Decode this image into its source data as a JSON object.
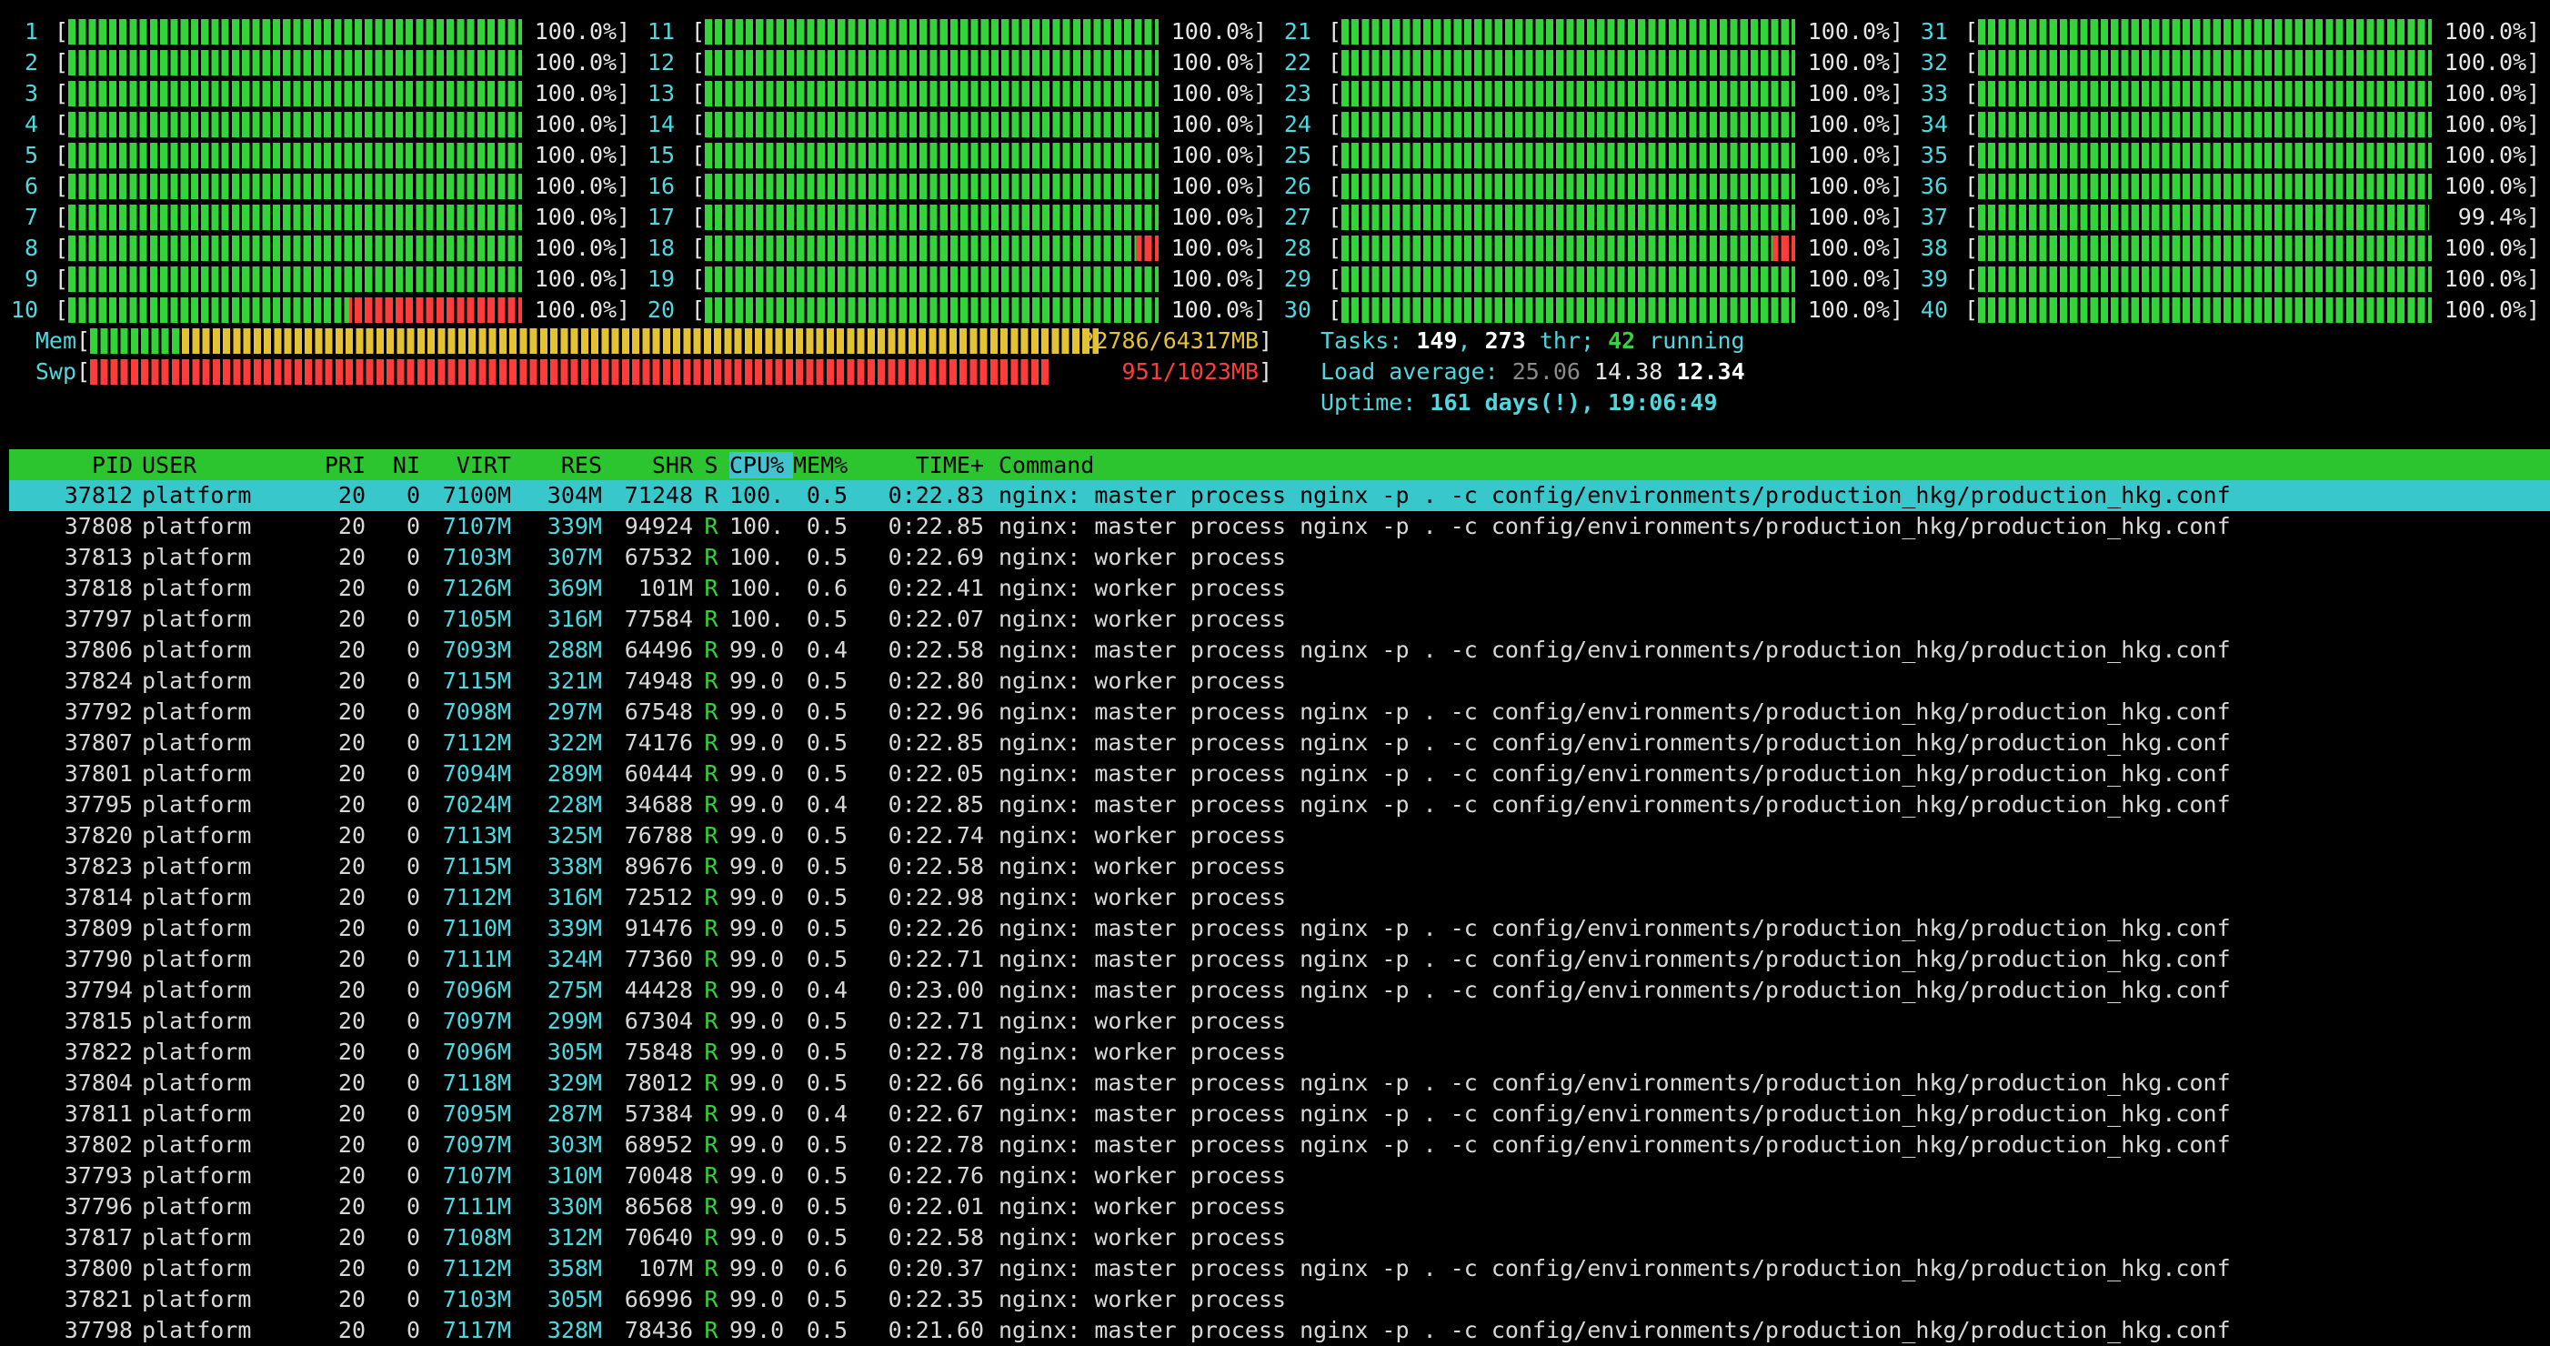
{
  "colors": {
    "green": "#33d43a",
    "red": "#ff3c3c",
    "cyan": "#4fd7df",
    "yellow": "#e3c234",
    "header_bg": "#2dc52f",
    "selected_bg": "#38c8cc"
  },
  "cpus": [
    {
      "n": "1",
      "pct": "100.0%",
      "usage": 1.0,
      "sys": 0
    },
    {
      "n": "2",
      "pct": "100.0%",
      "usage": 1.0,
      "sys": 0
    },
    {
      "n": "3",
      "pct": "100.0%",
      "usage": 1.0,
      "sys": 0
    },
    {
      "n": "4",
      "pct": "100.0%",
      "usage": 1.0,
      "sys": 0
    },
    {
      "n": "5",
      "pct": "100.0%",
      "usage": 1.0,
      "sys": 0
    },
    {
      "n": "6",
      "pct": "100.0%",
      "usage": 1.0,
      "sys": 0
    },
    {
      "n": "7",
      "pct": "100.0%",
      "usage": 1.0,
      "sys": 0
    },
    {
      "n": "8",
      "pct": "100.0%",
      "usage": 1.0,
      "sys": 0
    },
    {
      "n": "9",
      "pct": "100.0%",
      "usage": 1.0,
      "sys": 0
    },
    {
      "n": "10",
      "pct": "100.0%",
      "usage": 1.0,
      "sys": 0.38
    },
    {
      "n": "11",
      "pct": "100.0%",
      "usage": 1.0,
      "sys": 0
    },
    {
      "n": "12",
      "pct": "100.0%",
      "usage": 1.0,
      "sys": 0
    },
    {
      "n": "13",
      "pct": "100.0%",
      "usage": 1.0,
      "sys": 0
    },
    {
      "n": "14",
      "pct": "100.0%",
      "usage": 1.0,
      "sys": 0
    },
    {
      "n": "15",
      "pct": "100.0%",
      "usage": 1.0,
      "sys": 0
    },
    {
      "n": "16",
      "pct": "100.0%",
      "usage": 1.0,
      "sys": 0
    },
    {
      "n": "17",
      "pct": "100.0%",
      "usage": 1.0,
      "sys": 0
    },
    {
      "n": "18",
      "pct": "100.0%",
      "usage": 1.0,
      "sys": 0.05
    },
    {
      "n": "19",
      "pct": "100.0%",
      "usage": 1.0,
      "sys": 0
    },
    {
      "n": "20",
      "pct": "100.0%",
      "usage": 1.0,
      "sys": 0
    },
    {
      "n": "21",
      "pct": "100.0%",
      "usage": 1.0,
      "sys": 0
    },
    {
      "n": "22",
      "pct": "100.0%",
      "usage": 1.0,
      "sys": 0
    },
    {
      "n": "23",
      "pct": "100.0%",
      "usage": 1.0,
      "sys": 0
    },
    {
      "n": "24",
      "pct": "100.0%",
      "usage": 1.0,
      "sys": 0
    },
    {
      "n": "25",
      "pct": "100.0%",
      "usage": 1.0,
      "sys": 0
    },
    {
      "n": "26",
      "pct": "100.0%",
      "usage": 1.0,
      "sys": 0
    },
    {
      "n": "27",
      "pct": "100.0%",
      "usage": 1.0,
      "sys": 0
    },
    {
      "n": "28",
      "pct": "100.0%",
      "usage": 1.0,
      "sys": 0.05
    },
    {
      "n": "29",
      "pct": "100.0%",
      "usage": 1.0,
      "sys": 0
    },
    {
      "n": "30",
      "pct": "100.0%",
      "usage": 1.0,
      "sys": 0
    },
    {
      "n": "31",
      "pct": "100.0%",
      "usage": 1.0,
      "sys": 0
    },
    {
      "n": "32",
      "pct": "100.0%",
      "usage": 1.0,
      "sys": 0
    },
    {
      "n": "33",
      "pct": "100.0%",
      "usage": 1.0,
      "sys": 0
    },
    {
      "n": "34",
      "pct": "100.0%",
      "usage": 1.0,
      "sys": 0
    },
    {
      "n": "35",
      "pct": "100.0%",
      "usage": 1.0,
      "sys": 0
    },
    {
      "n": "36",
      "pct": "100.0%",
      "usage": 1.0,
      "sys": 0
    },
    {
      "n": "37",
      "pct": "99.4%",
      "usage": 0.994,
      "sys": 0
    },
    {
      "n": "38",
      "pct": "100.0%",
      "usage": 1.0,
      "sys": 0
    },
    {
      "n": "39",
      "pct": "100.0%",
      "usage": 1.0,
      "sys": 0
    },
    {
      "n": "40",
      "pct": "100.0%",
      "usage": 1.0,
      "sys": 0
    }
  ],
  "mem": {
    "label": "Mem",
    "value": "22786/64317MB",
    "used": 0.354
  },
  "swp": {
    "label": "Swp",
    "value": "951/1023MB",
    "used": 0.93
  },
  "tasks": {
    "label": "Tasks: ",
    "count": "149",
    "sep": ", ",
    "threads": "273",
    "thr_label": " thr; ",
    "running": "42",
    "running_label": " running"
  },
  "load": {
    "label": "Load average: ",
    "l1": "25.06",
    "l5": "14.38",
    "l15": "12.34"
  },
  "uptime": {
    "label": "Uptime: ",
    "value": "161 days(!), 19:06:49"
  },
  "header": {
    "pid": "PID",
    "user": "USER",
    "pri": "PRI",
    "ni": "NI",
    "virt": "VIRT",
    "res": "RES",
    "shr": "SHR",
    "s": "S",
    "cpu": "CPU%",
    "mem": "MEM%",
    "time": "TIME+",
    "command": "Command"
  },
  "processes": [
    {
      "pid": "37812",
      "user": "platform",
      "pri": "20",
      "ni": "0",
      "virt": "7100M",
      "res": "304M",
      "shr": "71248",
      "s": "R",
      "cpu": "100.",
      "mem": "0.5",
      "time": "0:22.83",
      "cmd": "nginx: master process nginx -p . -c config/environments/production_hkg/production_hkg.conf"
    },
    {
      "pid": "37808",
      "user": "platform",
      "pri": "20",
      "ni": "0",
      "virt": "7107M",
      "res": "339M",
      "shr": "94924",
      "s": "R",
      "cpu": "100.",
      "mem": "0.5",
      "time": "0:22.85",
      "cmd": "nginx: master process nginx -p . -c config/environments/production_hkg/production_hkg.conf"
    },
    {
      "pid": "37813",
      "user": "platform",
      "pri": "20",
      "ni": "0",
      "virt": "7103M",
      "res": "307M",
      "shr": "67532",
      "s": "R",
      "cpu": "100.",
      "mem": "0.5",
      "time": "0:22.69",
      "cmd": "nginx: worker process"
    },
    {
      "pid": "37818",
      "user": "platform",
      "pri": "20",
      "ni": "0",
      "virt": "7126M",
      "res": "369M",
      "shr": "101M",
      "s": "R",
      "cpu": "100.",
      "mem": "0.6",
      "time": "0:22.41",
      "cmd": "nginx: worker process"
    },
    {
      "pid": "37797",
      "user": "platform",
      "pri": "20",
      "ni": "0",
      "virt": "7105M",
      "res": "316M",
      "shr": "77584",
      "s": "R",
      "cpu": "100.",
      "mem": "0.5",
      "time": "0:22.07",
      "cmd": "nginx: worker process"
    },
    {
      "pid": "37806",
      "user": "platform",
      "pri": "20",
      "ni": "0",
      "virt": "7093M",
      "res": "288M",
      "shr": "64496",
      "s": "R",
      "cpu": "99.0",
      "mem": "0.4",
      "time": "0:22.58",
      "cmd": "nginx: master process nginx -p . -c config/environments/production_hkg/production_hkg.conf"
    },
    {
      "pid": "37824",
      "user": "platform",
      "pri": "20",
      "ni": "0",
      "virt": "7115M",
      "res": "321M",
      "shr": "74948",
      "s": "R",
      "cpu": "99.0",
      "mem": "0.5",
      "time": "0:22.80",
      "cmd": "nginx: worker process"
    },
    {
      "pid": "37792",
      "user": "platform",
      "pri": "20",
      "ni": "0",
      "virt": "7098M",
      "res": "297M",
      "shr": "67548",
      "s": "R",
      "cpu": "99.0",
      "mem": "0.5",
      "time": "0:22.96",
      "cmd": "nginx: master process nginx -p . -c config/environments/production_hkg/production_hkg.conf"
    },
    {
      "pid": "37807",
      "user": "platform",
      "pri": "20",
      "ni": "0",
      "virt": "7112M",
      "res": "322M",
      "shr": "74176",
      "s": "R",
      "cpu": "99.0",
      "mem": "0.5",
      "time": "0:22.85",
      "cmd": "nginx: master process nginx -p . -c config/environments/production_hkg/production_hkg.conf"
    },
    {
      "pid": "37801",
      "user": "platform",
      "pri": "20",
      "ni": "0",
      "virt": "7094M",
      "res": "289M",
      "shr": "60444",
      "s": "R",
      "cpu": "99.0",
      "mem": "0.5",
      "time": "0:22.05",
      "cmd": "nginx: master process nginx -p . -c config/environments/production_hkg/production_hkg.conf"
    },
    {
      "pid": "37795",
      "user": "platform",
      "pri": "20",
      "ni": "0",
      "virt": "7024M",
      "res": "228M",
      "shr": "34688",
      "s": "R",
      "cpu": "99.0",
      "mem": "0.4",
      "time": "0:22.85",
      "cmd": "nginx: master process nginx -p . -c config/environments/production_hkg/production_hkg.conf"
    },
    {
      "pid": "37820",
      "user": "platform",
      "pri": "20",
      "ni": "0",
      "virt": "7113M",
      "res": "325M",
      "shr": "76788",
      "s": "R",
      "cpu": "99.0",
      "mem": "0.5",
      "time": "0:22.74",
      "cmd": "nginx: worker process"
    },
    {
      "pid": "37823",
      "user": "platform",
      "pri": "20",
      "ni": "0",
      "virt": "7115M",
      "res": "338M",
      "shr": "89676",
      "s": "R",
      "cpu": "99.0",
      "mem": "0.5",
      "time": "0:22.58",
      "cmd": "nginx: worker process"
    },
    {
      "pid": "37814",
      "user": "platform",
      "pri": "20",
      "ni": "0",
      "virt": "7112M",
      "res": "316M",
      "shr": "72512",
      "s": "R",
      "cpu": "99.0",
      "mem": "0.5",
      "time": "0:22.98",
      "cmd": "nginx: worker process"
    },
    {
      "pid": "37809",
      "user": "platform",
      "pri": "20",
      "ni": "0",
      "virt": "7110M",
      "res": "339M",
      "shr": "91476",
      "s": "R",
      "cpu": "99.0",
      "mem": "0.5",
      "time": "0:22.26",
      "cmd": "nginx: master process nginx -p . -c config/environments/production_hkg/production_hkg.conf"
    },
    {
      "pid": "37790",
      "user": "platform",
      "pri": "20",
      "ni": "0",
      "virt": "7111M",
      "res": "324M",
      "shr": "77360",
      "s": "R",
      "cpu": "99.0",
      "mem": "0.5",
      "time": "0:22.71",
      "cmd": "nginx: master process nginx -p . -c config/environments/production_hkg/production_hkg.conf"
    },
    {
      "pid": "37794",
      "user": "platform",
      "pri": "20",
      "ni": "0",
      "virt": "7096M",
      "res": "275M",
      "shr": "44428",
      "s": "R",
      "cpu": "99.0",
      "mem": "0.4",
      "time": "0:23.00",
      "cmd": "nginx: master process nginx -p . -c config/environments/production_hkg/production_hkg.conf"
    },
    {
      "pid": "37815",
      "user": "platform",
      "pri": "20",
      "ni": "0",
      "virt": "7097M",
      "res": "299M",
      "shr": "67304",
      "s": "R",
      "cpu": "99.0",
      "mem": "0.5",
      "time": "0:22.71",
      "cmd": "nginx: worker process"
    },
    {
      "pid": "37822",
      "user": "platform",
      "pri": "20",
      "ni": "0",
      "virt": "7096M",
      "res": "305M",
      "shr": "75848",
      "s": "R",
      "cpu": "99.0",
      "mem": "0.5",
      "time": "0:22.78",
      "cmd": "nginx: worker process"
    },
    {
      "pid": "37804",
      "user": "platform",
      "pri": "20",
      "ni": "0",
      "virt": "7118M",
      "res": "329M",
      "shr": "78012",
      "s": "R",
      "cpu": "99.0",
      "mem": "0.5",
      "time": "0:22.66",
      "cmd": "nginx: master process nginx -p . -c config/environments/production_hkg/production_hkg.conf"
    },
    {
      "pid": "37811",
      "user": "platform",
      "pri": "20",
      "ni": "0",
      "virt": "7095M",
      "res": "287M",
      "shr": "57384",
      "s": "R",
      "cpu": "99.0",
      "mem": "0.4",
      "time": "0:22.67",
      "cmd": "nginx: master process nginx -p . -c config/environments/production_hkg/production_hkg.conf"
    },
    {
      "pid": "37802",
      "user": "platform",
      "pri": "20",
      "ni": "0",
      "virt": "7097M",
      "res": "303M",
      "shr": "68952",
      "s": "R",
      "cpu": "99.0",
      "mem": "0.5",
      "time": "0:22.78",
      "cmd": "nginx: master process nginx -p . -c config/environments/production_hkg/production_hkg.conf"
    },
    {
      "pid": "37793",
      "user": "platform",
      "pri": "20",
      "ni": "0",
      "virt": "7107M",
      "res": "310M",
      "shr": "70048",
      "s": "R",
      "cpu": "99.0",
      "mem": "0.5",
      "time": "0:22.76",
      "cmd": "nginx: worker process"
    },
    {
      "pid": "37796",
      "user": "platform",
      "pri": "20",
      "ni": "0",
      "virt": "7111M",
      "res": "330M",
      "shr": "86568",
      "s": "R",
      "cpu": "99.0",
      "mem": "0.5",
      "time": "0:22.01",
      "cmd": "nginx: worker process"
    },
    {
      "pid": "37817",
      "user": "platform",
      "pri": "20",
      "ni": "0",
      "virt": "7108M",
      "res": "312M",
      "shr": "70640",
      "s": "R",
      "cpu": "99.0",
      "mem": "0.5",
      "time": "0:22.58",
      "cmd": "nginx: worker process"
    },
    {
      "pid": "37800",
      "user": "platform",
      "pri": "20",
      "ni": "0",
      "virt": "7112M",
      "res": "358M",
      "shr": "107M",
      "s": "R",
      "cpu": "99.0",
      "mem": "0.6",
      "time": "0:20.37",
      "cmd": "nginx: master process nginx -p . -c config/environments/production_hkg/production_hkg.conf"
    },
    {
      "pid": "37821",
      "user": "platform",
      "pri": "20",
      "ni": "0",
      "virt": "7103M",
      "res": "305M",
      "shr": "66996",
      "s": "R",
      "cpu": "99.0",
      "mem": "0.5",
      "time": "0:22.35",
      "cmd": "nginx: worker process"
    },
    {
      "pid": "37798",
      "user": "platform",
      "pri": "20",
      "ni": "0",
      "virt": "7117M",
      "res": "328M",
      "shr": "78436",
      "s": "R",
      "cpu": "99.0",
      "mem": "0.5",
      "time": "0:21.60",
      "cmd": "nginx: master process nginx -p . -c config/environments/production_hkg/production_hkg.conf"
    }
  ]
}
